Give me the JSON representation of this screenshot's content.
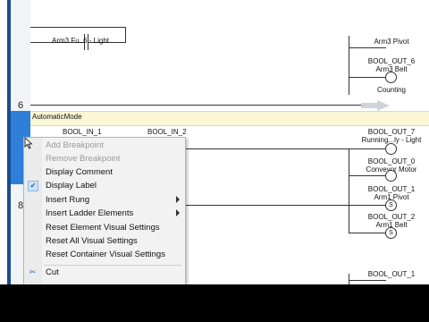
{
  "rungs": {
    "rung6_label": "6",
    "rung8_label": "8",
    "mode_label": "AutomaticMode"
  },
  "top_section": {
    "contact_partial": "Arm3 Fu..6 - Light",
    "coil_arm_pivot_top": "Arm3 Pivot",
    "coil_out6_tag": "BOOL_OUT_6",
    "coil_out6_desc": "Arm3 Belt",
    "coil_counting": "Counting"
  },
  "rung7": {
    "contact1_tag": "BOOL_IN_1",
    "contact2_tag": "BOOL_IN_2",
    "coil_out7_tag": "BOOL_OUT_7",
    "coil_out7_desc": "Running...ly - Light",
    "coil_out0_tag": "BOOL_OUT_0",
    "coil_out0_desc": "Conveyor Motor",
    "coil_out1_tag": "BOOL_OUT_1",
    "coil_out1_desc": "Arm1 Pivot",
    "coil_out1_type": "S",
    "coil_out2_tag": "BOOL_OUT_2",
    "coil_out2_desc": "Arm1 Belt",
    "coil_out2_type": "S"
  },
  "bottom_section": {
    "coil_bottom_tag": "BOOL_OUT_1"
  },
  "context_menu": {
    "items": [
      {
        "label": "Add Breakpoint",
        "enabled": false
      },
      {
        "label": "Remove Breakpoint",
        "enabled": false
      },
      {
        "label": "Display Comment",
        "enabled": true
      },
      {
        "label": "Display Label",
        "enabled": true,
        "checked": true
      },
      {
        "label": "Insert Rung",
        "enabled": true,
        "submenu": true
      },
      {
        "label": "Insert Ladder Elements",
        "enabled": true,
        "submenu": true
      },
      {
        "label": "Reset Element Visual Settings",
        "enabled": true
      },
      {
        "label": "Reset All Visual Settings",
        "enabled": true
      },
      {
        "label": "Reset Container Visual Settings",
        "enabled": true
      },
      {
        "label": "Cut",
        "enabled": true,
        "icon": "scissors-icon"
      }
    ]
  },
  "colors": {
    "selected_gutter": "#2f7fd8",
    "mode_band": "#fbf6d4",
    "disabled_text": "#9a9a9a"
  }
}
